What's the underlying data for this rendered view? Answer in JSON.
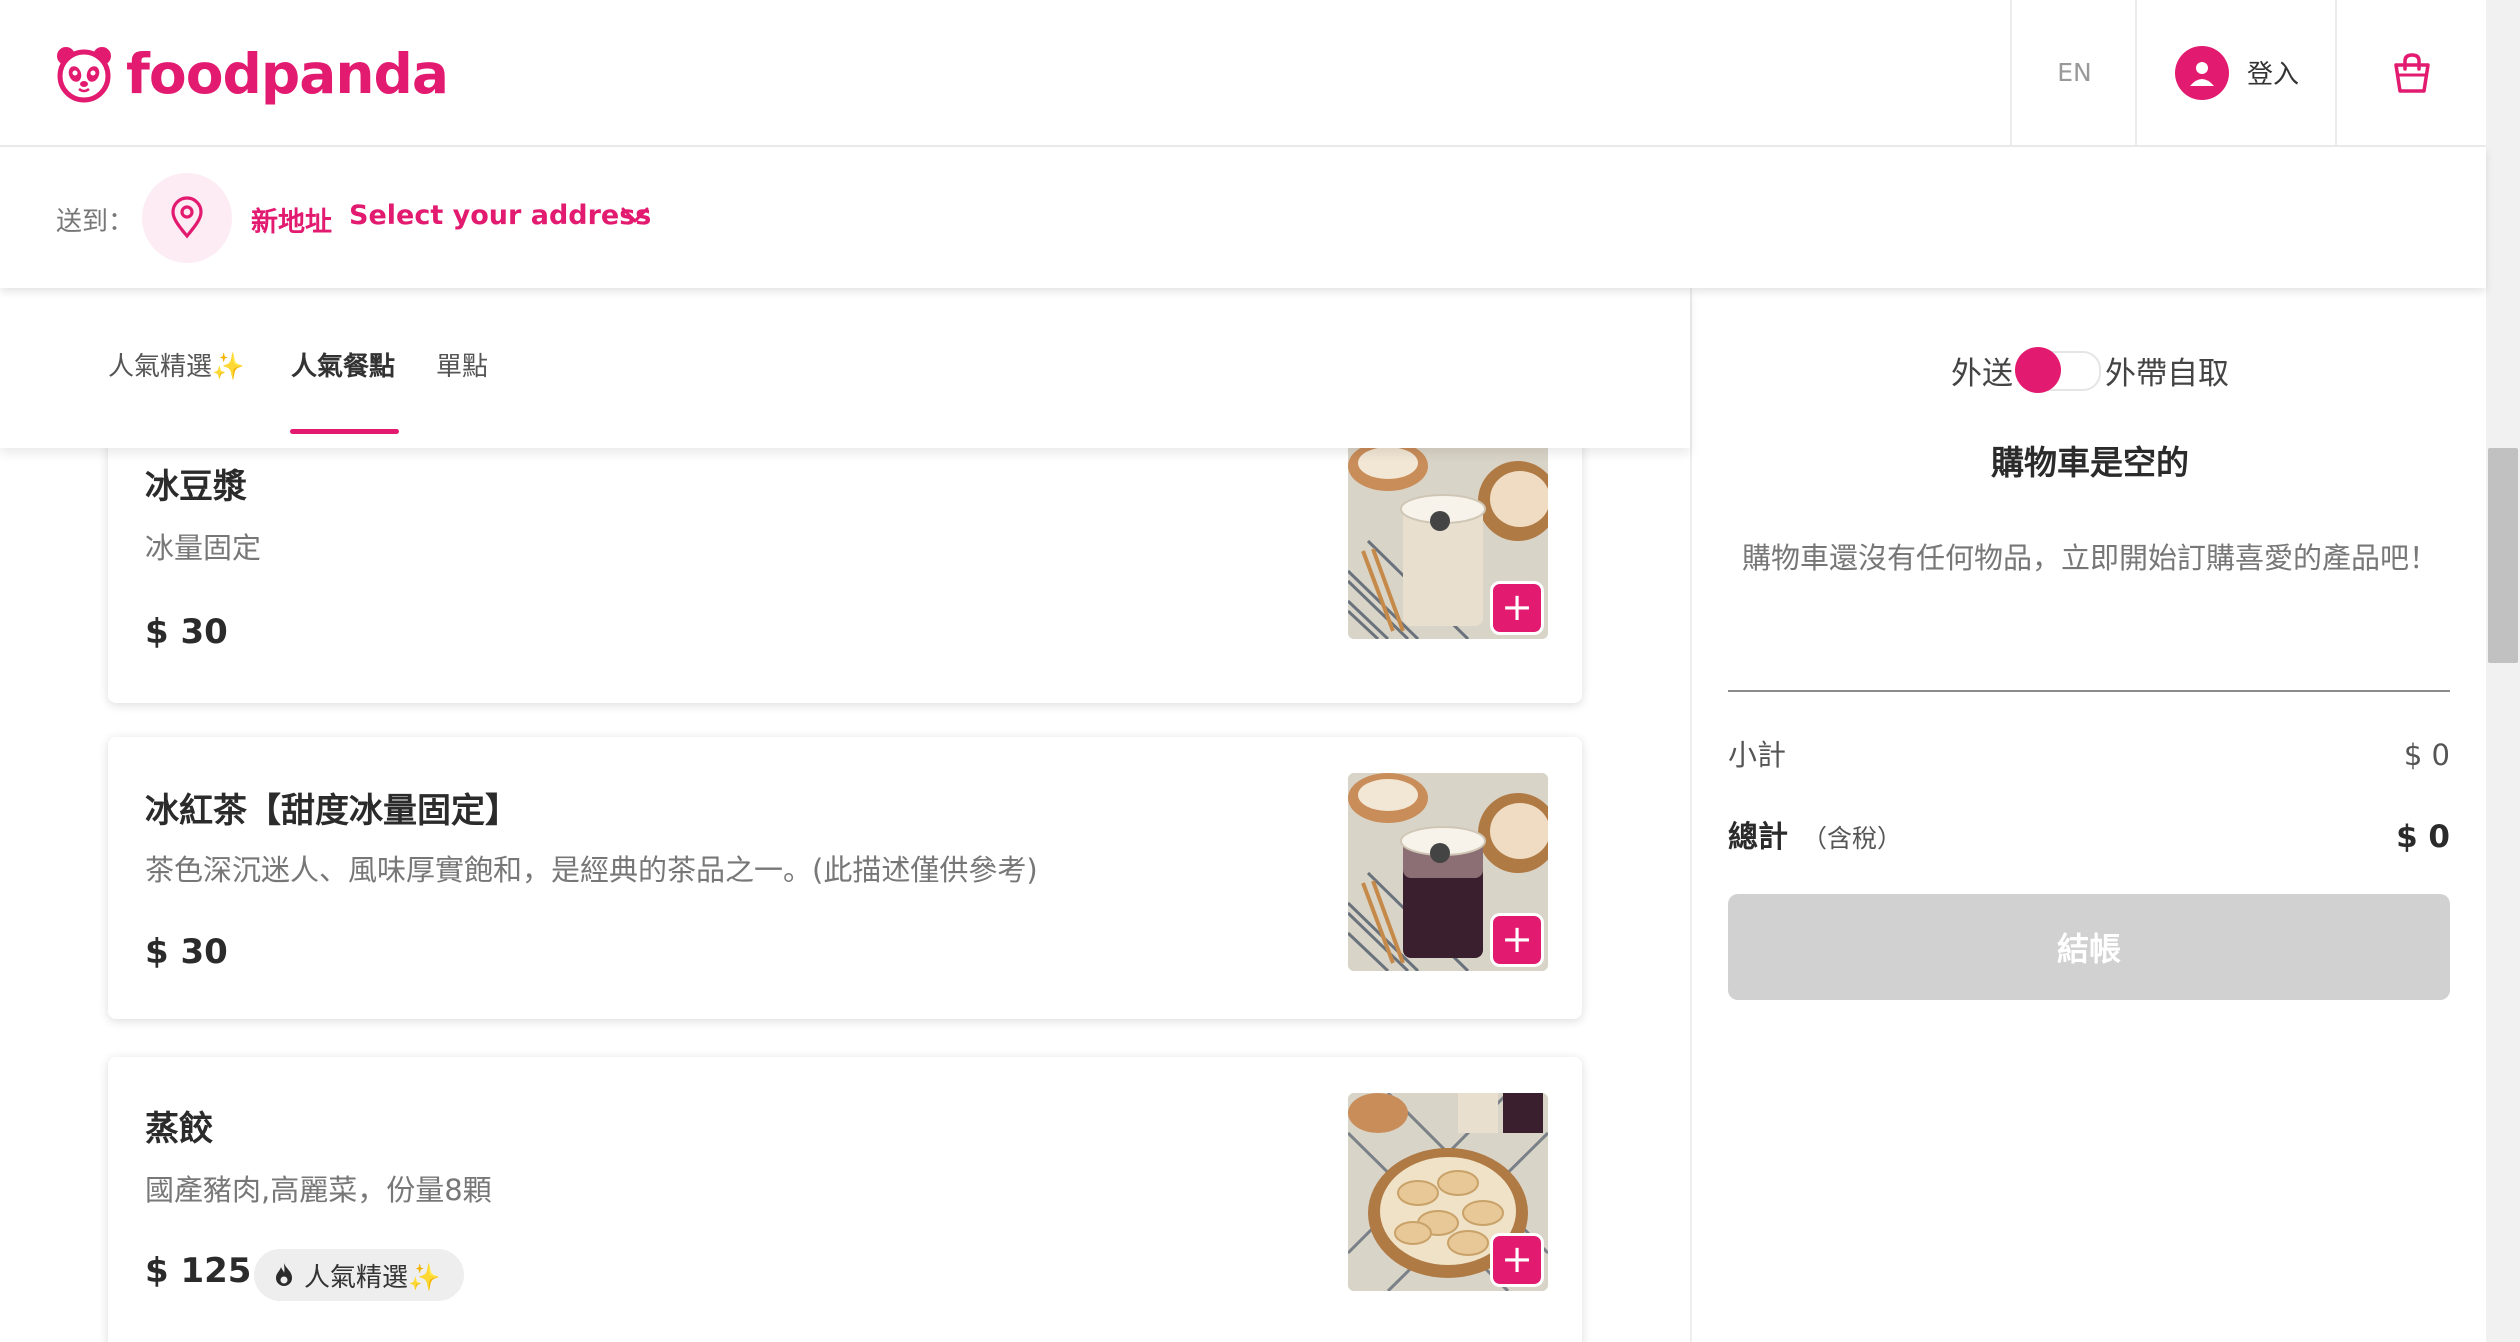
{
  "brand": {
    "name": "foodpanda",
    "color": "#e21b70"
  },
  "header": {
    "language": "EN",
    "login_label": "登入",
    "icons": [
      "panda-logo-icon",
      "user-icon",
      "shopping-bag-icon"
    ]
  },
  "address": {
    "prefix": "送到：",
    "new_label": "新地址",
    "select_label": "Select your address",
    "icons": [
      "location-pin-icon",
      "chevron-down-icon"
    ]
  },
  "tabs": [
    {
      "label": "人氣精選✨",
      "active": false
    },
    {
      "label": "人氣餐點",
      "active": true
    },
    {
      "label": "單點",
      "active": false
    }
  ],
  "menu": {
    "items": [
      {
        "name": "冰豆漿",
        "description": "冰量固定",
        "price": "$ 30",
        "badge": null
      },
      {
        "name": "冰紅茶【甜度冰量固定】",
        "description": "茶色深沉迷人、風味厚實飽和，是經典的茶品之一。(此描述僅供參考)",
        "price": "$ 30",
        "badge": null
      },
      {
        "name": "蒸餃",
        "description": "國產豬肉,高麗菜，份量8顆",
        "price": "$ 125",
        "badge": "人氣精選✨"
      }
    ],
    "add_symbol": "+"
  },
  "cart": {
    "toggle_left": "外送",
    "toggle_right": "外帶自取",
    "delivery_selected": true,
    "title": "購物車是空的",
    "empty_message": "購物車還沒有任何物品，立即開始訂購喜愛的產品吧！",
    "subtotal_label": "小計",
    "subtotal_value": "$ 0",
    "total_label": "總計",
    "total_note": "（含稅）",
    "total_value": "$ 0",
    "checkout_label": "結帳"
  }
}
